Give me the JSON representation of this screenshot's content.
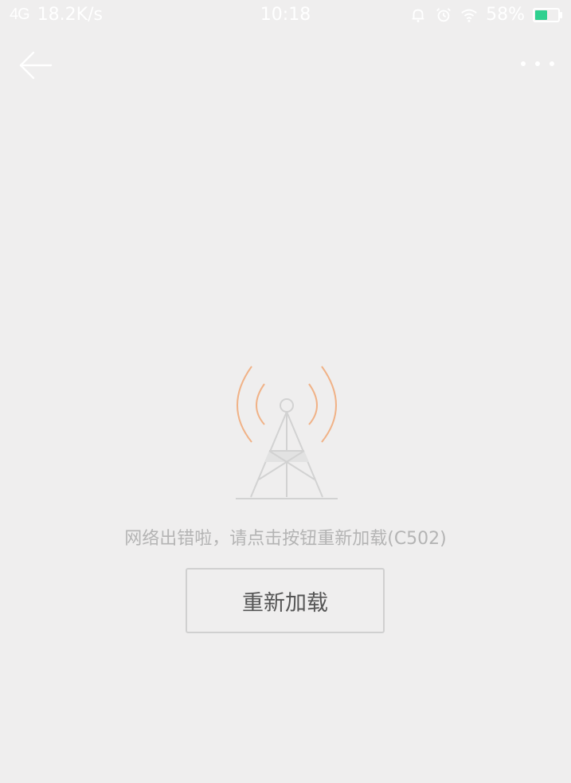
{
  "status_bar": {
    "signal": "4G",
    "net_speed": "18.2K/s",
    "time": "10:18",
    "battery_percent": "58%",
    "battery_level": 0.58,
    "icons": [
      "bell-icon",
      "alarm-icon",
      "wifi-icon"
    ],
    "battery_color": "#2ed08f"
  },
  "nav": {
    "back_icon": "back-arrow-icon",
    "more_icon": "more-dots-icon"
  },
  "error": {
    "icon": "signal-tower-icon",
    "message": "网络出错啦，请点击按钮重新加载(C502)",
    "reload_label": "重新加载",
    "accent_color": "#f0b287"
  }
}
